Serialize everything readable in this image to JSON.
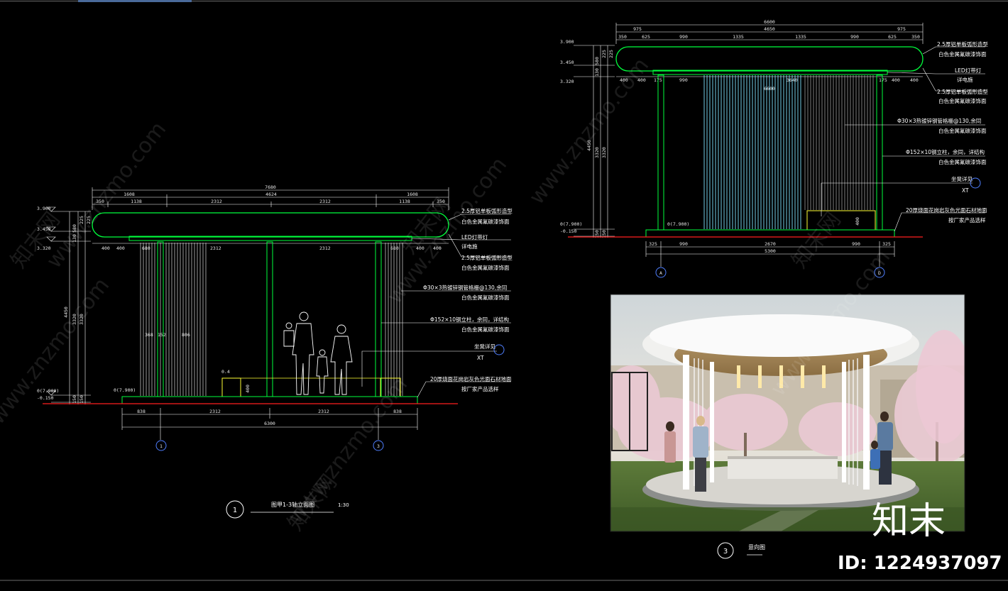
{
  "drawing_1": {
    "title": "图甲1-3轴立面图",
    "scale": "1:30",
    "number": "1",
    "levels": [
      "3.900",
      "3.450",
      "3.320",
      "0(7.900)",
      "-0.150"
    ],
    "top_total": "7680",
    "top_segments": [
      "1608",
      "4624",
      "1608"
    ],
    "top_sub": [
      "350",
      "1138",
      "2312",
      "2312",
      "1138",
      "350"
    ],
    "under_roof": [
      "400",
      "400",
      "680",
      "2312",
      "2312",
      "680",
      "400",
      "400"
    ],
    "left_vertical": [
      "4450",
      "3320",
      "3320",
      "580",
      "130",
      "225",
      "225",
      "150",
      "150"
    ],
    "inner": [
      "368",
      "152",
      "806"
    ],
    "bottom_segments": [
      "838",
      "2312",
      "2312",
      "838"
    ],
    "bottom_total": "6300",
    "bench_label": "0.4",
    "bench_height": "400",
    "axis_left": "1",
    "axis_right": "3",
    "detail_ref": "XT",
    "notes": [
      "2.5厚铝单板弧形造型",
      "白色金属氟碳漆饰面",
      "LED灯带灯",
      "详电施",
      "2.5厚铝单板弧形造型",
      "白色金属氟碳漆饰面",
      "Φ30×3热镀锌钢管格栅@130,余同",
      "白色金属氟碳漆饰面",
      "Φ152×10钢立柱，余同，详结构",
      "白色金属氟碳漆饰面",
      "坐凳详见",
      "20厚烧面花岗岩灰色光面石材地面",
      "按厂家产品选样"
    ]
  },
  "drawing_2": {
    "levels": [
      "3.900",
      "3.450",
      "3.320",
      "0(7.900)",
      "-0.150"
    ],
    "top_total": "6600",
    "top_mid": "4650",
    "top_segments": [
      "975",
      "4650",
      "975"
    ],
    "top_sub": [
      "350",
      "625",
      "990",
      "1335",
      "1335",
      "990",
      "625",
      "350"
    ],
    "under_roof": [
      "400",
      "400",
      "175",
      "990",
      "3640",
      "175",
      "400",
      "400"
    ],
    "under_roof_total": "6600",
    "left_vertical": [
      "4450",
      "3320",
      "3320",
      "580",
      "130",
      "225",
      "225",
      "150",
      "150"
    ],
    "bottom_segments": [
      "325",
      "990",
      "2670",
      "990",
      "325"
    ],
    "bottom_total": "5300",
    "axis_left": "A",
    "axis_right": "D",
    "detail_ref": "XT",
    "bench_height": "400",
    "notes": [
      "2.5厚铝单板弧形造型",
      "白色金属氟碳漆饰面",
      "LED灯带灯",
      "详电施",
      "2.5厚铝单板弧形造型",
      "白色金属氟碳漆饰面",
      "Φ30×3热镀锌钢管格栅@130,余同",
      "白色金属氟碳漆饰面",
      "Φ152×10钢立柱，余同，详结构",
      "白色金属氟碳漆饰面",
      "坐凳详见",
      "20厚烧面花岗岩灰色光面石材地面",
      "按厂家产品选样"
    ]
  },
  "rendering": {
    "number": "3",
    "label": "意向图"
  },
  "watermark": "www.znzmo.com",
  "watermark_cn": "知末网",
  "brand_logo": "知末",
  "id_text": "ID: 1224937097",
  "colors": {
    "background": "#000000",
    "outline_green": "#00ff3c",
    "dimension": "#ffffff",
    "grille_cyan": "#7fe3ff",
    "ground_red": "#ff1f1f",
    "bench_yellow": "#ffff33",
    "leader_blue": "#4f7fff"
  }
}
